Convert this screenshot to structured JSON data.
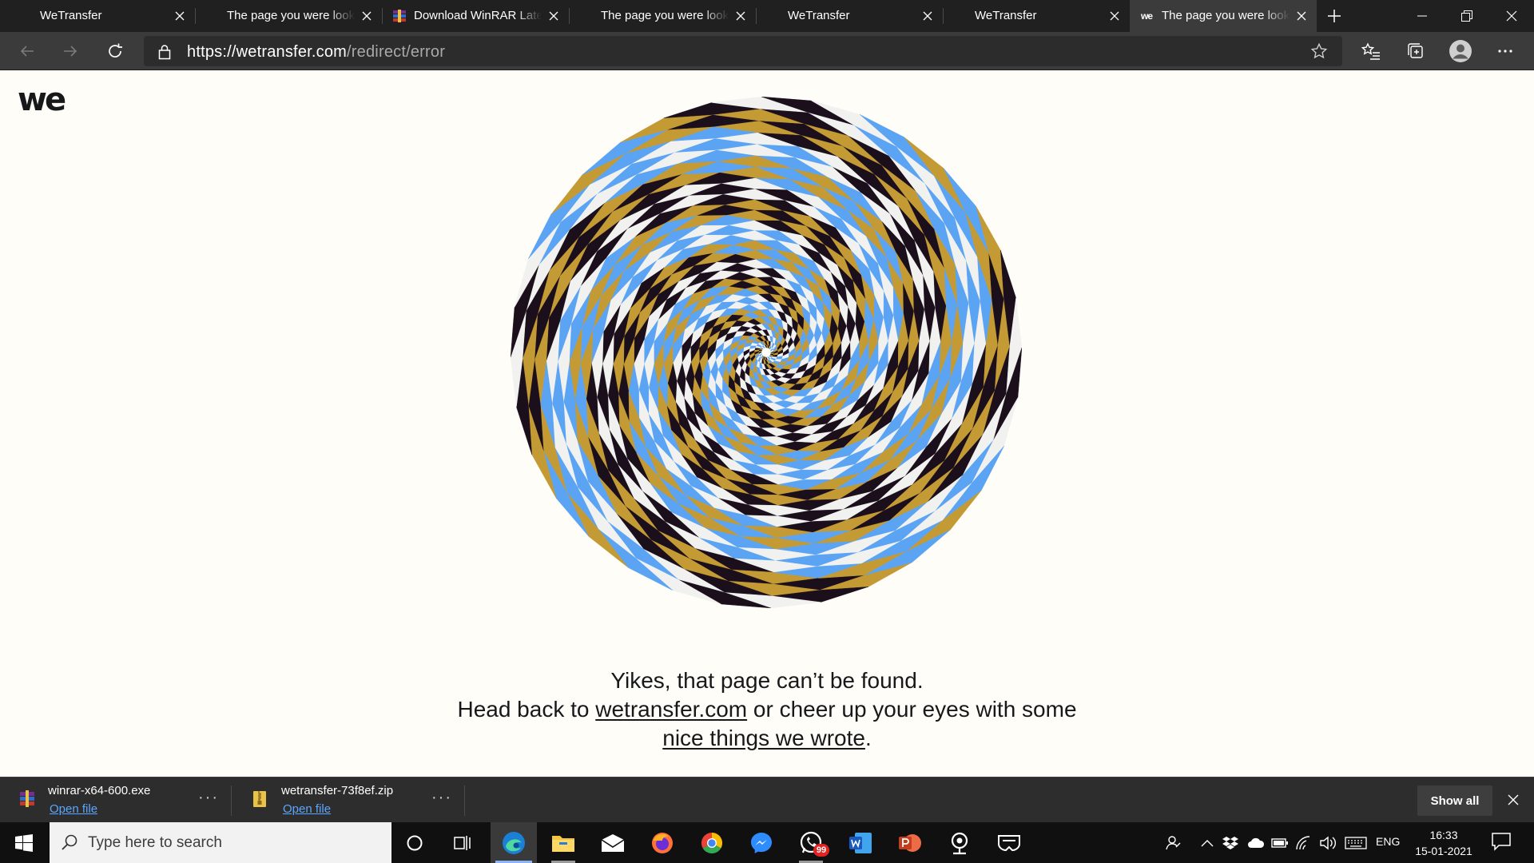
{
  "browser": {
    "tabs": [
      {
        "title": "WeTransfer",
        "favicon": "wetransfer-icon",
        "active": false
      },
      {
        "title": "The page you were looking for",
        "favicon": "wetransfer-icon",
        "active": false
      },
      {
        "title": "Download WinRAR Latest",
        "favicon": "winrar-icon",
        "active": false
      },
      {
        "title": "The page you were looking for",
        "favicon": "wetransfer-icon",
        "active": false
      },
      {
        "title": "WeTransfer",
        "favicon": "wetransfer-icon",
        "active": false
      },
      {
        "title": "WeTransfer",
        "favicon": "wetransfer-icon",
        "active": false
      },
      {
        "title": "The page you were looking for",
        "favicon": "wetransfer-icon",
        "active": true
      }
    ],
    "address": {
      "scheme_host": "https://wetransfer.com",
      "path": "/redirect/error"
    }
  },
  "page": {
    "logo_text": "we",
    "spiral_colors": [
      "#1b0f1c",
      "#c39a33",
      "#f1f1ef",
      "#5ba3f3"
    ],
    "message": {
      "line1": "Yikes, that page can’t be found.",
      "line2_prefix": "Head back to ",
      "link1": "wetransfer.com",
      "line2_middle": " or cheer up your eyes with some ",
      "link2": "nice things we wrote",
      "line2_suffix": "."
    }
  },
  "downloads": {
    "items": [
      {
        "filename": "winrar-x64-600.exe",
        "action": "Open file",
        "icon": "winrar-file-icon"
      },
      {
        "filename": "wetransfer-73f8ef.zip",
        "action": "Open file",
        "icon": "zip-file-icon"
      }
    ],
    "show_all_label": "Show all"
  },
  "taskbar": {
    "search_placeholder": "Type here to search",
    "whatsapp_badge": "99",
    "language": "ENG",
    "time": "16:33",
    "date": "15-01-2021"
  }
}
